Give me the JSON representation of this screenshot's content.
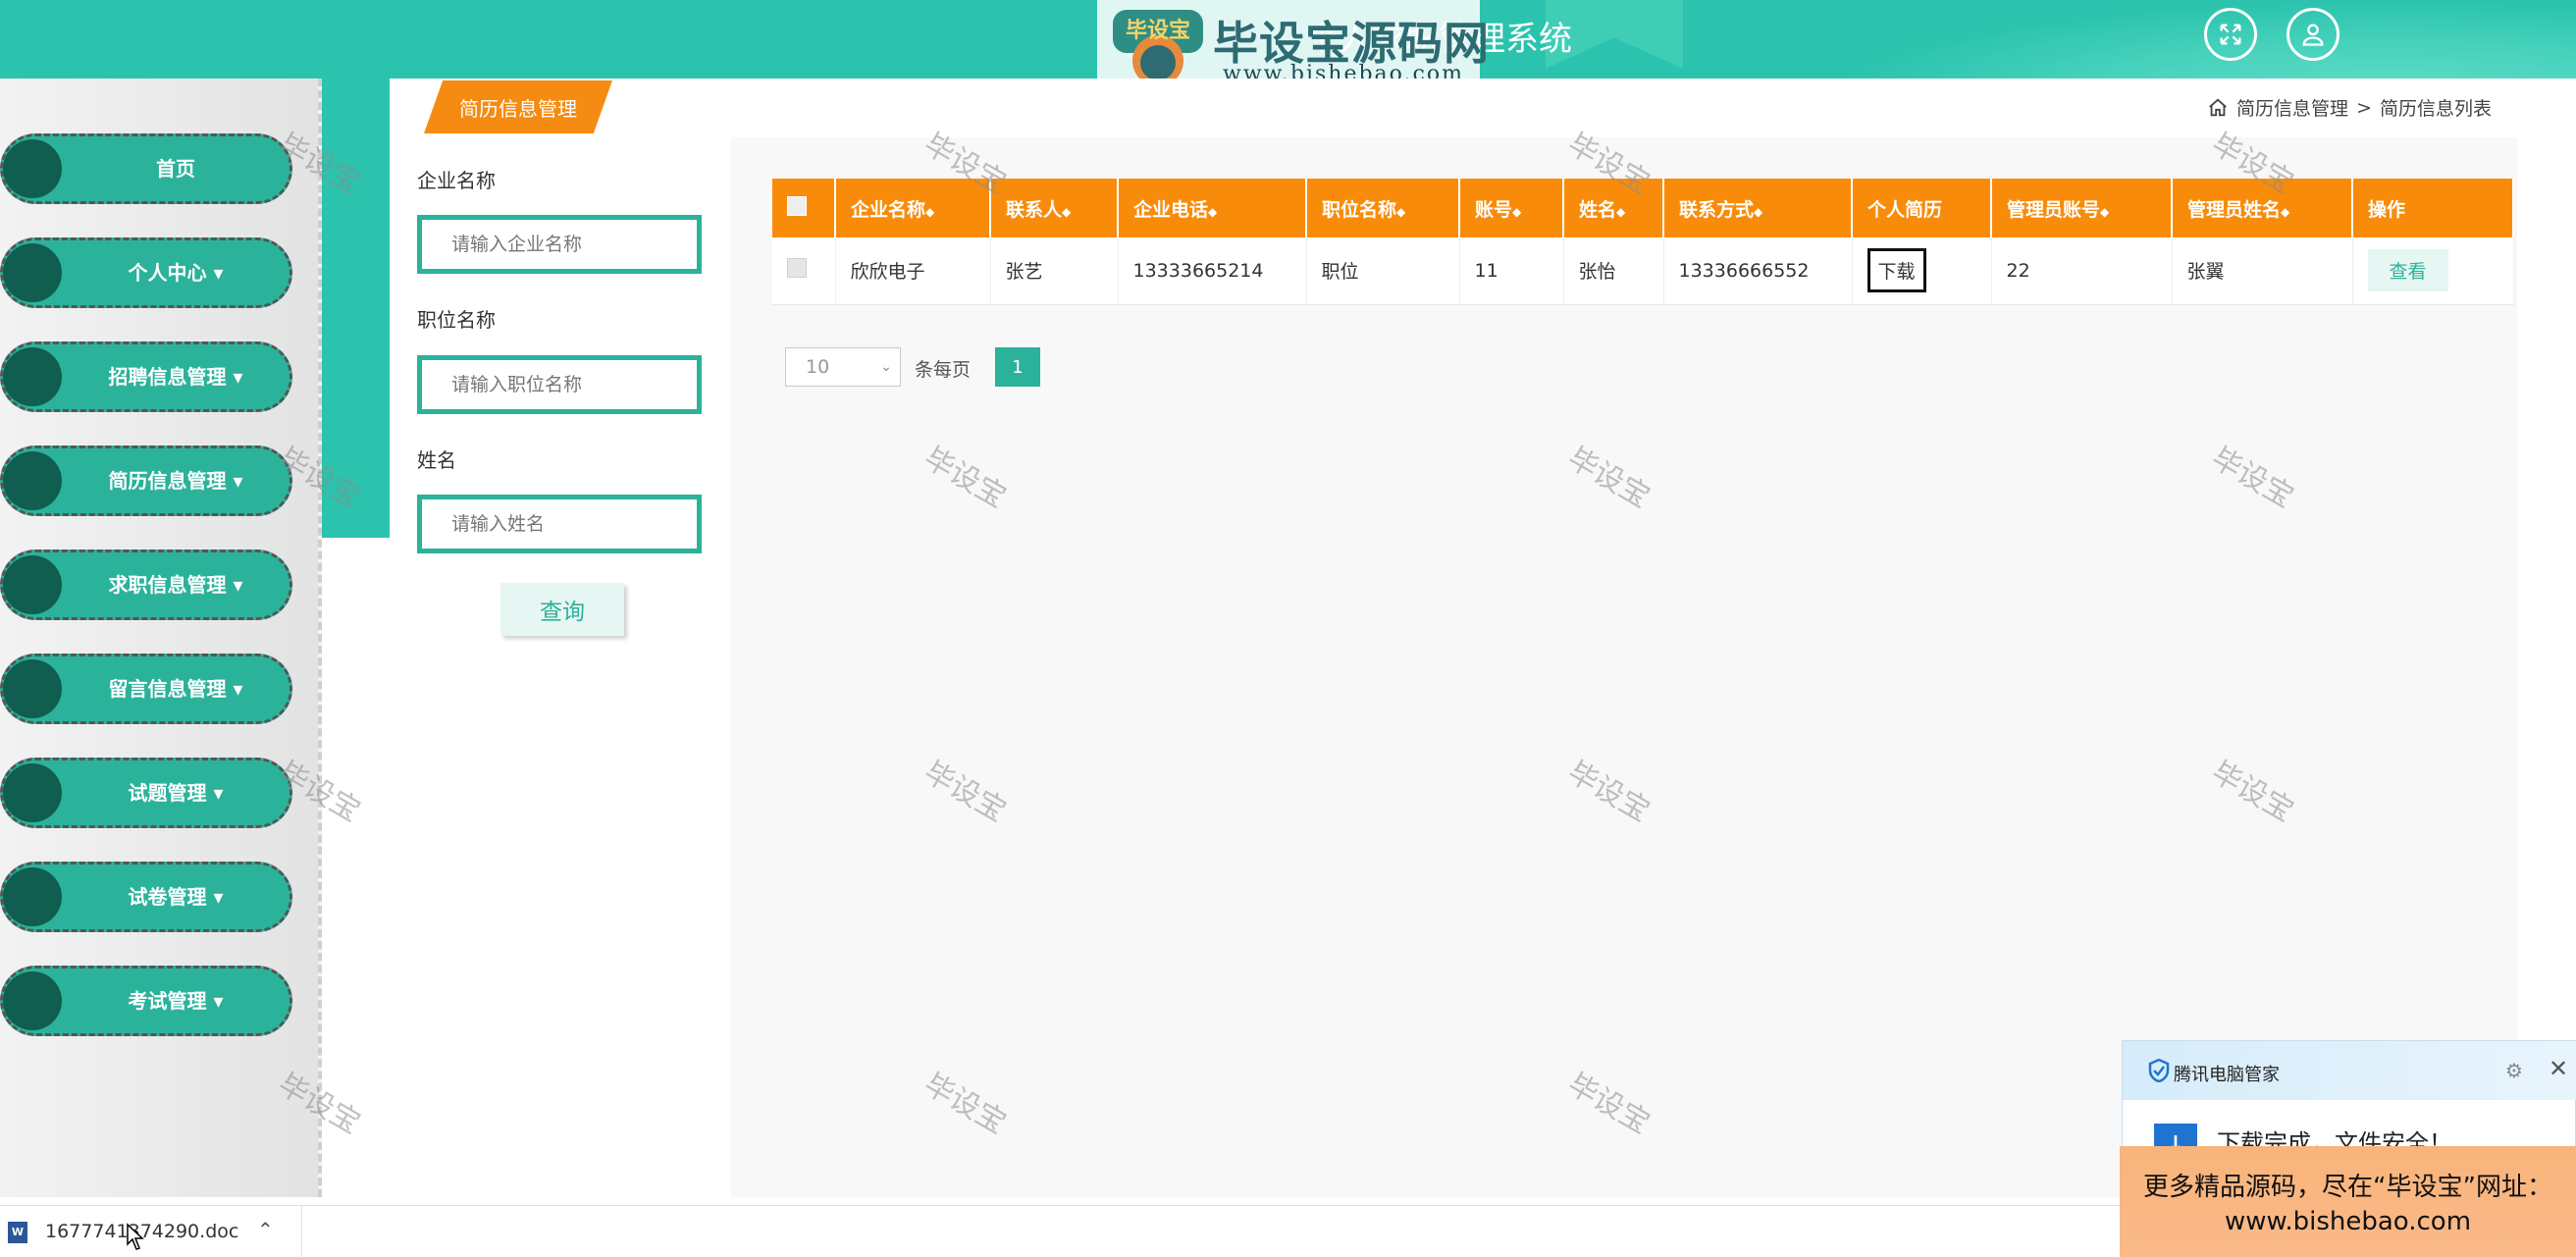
{
  "header": {
    "system_title": "个人求职管理系统",
    "icons": [
      "fullscreen-icon",
      "user-icon"
    ]
  },
  "watermark_logo": {
    "badge_text": "毕设宝",
    "main_text": "毕设宝源码网",
    "url": "www.bishebao.com"
  },
  "sidebar": {
    "items": [
      {
        "label": "首页"
      },
      {
        "label": "个人中心 ▾"
      },
      {
        "label": "招聘信息管理 ▾"
      },
      {
        "label": "简历信息管理 ▾"
      },
      {
        "label": "求职信息管理 ▾"
      },
      {
        "label": "留言信息管理 ▾"
      },
      {
        "label": "试题管理 ▾"
      },
      {
        "label": "试卷管理 ▾"
      },
      {
        "label": "考试管理 ▾"
      }
    ]
  },
  "panel": {
    "tab_label": "简历信息管理",
    "breadcrumb": {
      "home_icon": "home-icon",
      "level1": "简历信息管理",
      "separator": ">",
      "level2": "简历信息列表"
    }
  },
  "filters": {
    "company_label": "企业名称",
    "company_placeholder": "请输入企业名称",
    "position_label": "职位名称",
    "position_placeholder": "请输入职位名称",
    "name_label": "姓名",
    "name_placeholder": "请输入姓名",
    "query_button": "查询"
  },
  "table": {
    "columns": [
      "企业名称",
      "联系人",
      "企业电话",
      "职位名称",
      "账号",
      "姓名",
      "联系方式",
      "个人简历",
      "管理员账号",
      "管理员姓名",
      "操作"
    ],
    "sort_marker": "◆",
    "rows": [
      {
        "company": "欣欣电子",
        "contact": "张艺",
        "company_phone": "13333665214",
        "position": "职位",
        "account": "11",
        "name": "张怡",
        "contact_info": "13336666552",
        "resume_button": "下载",
        "admin_account": "22",
        "admin_name": "张翼",
        "action_button": "查看"
      }
    ]
  },
  "pagination": {
    "page_size": "10",
    "per_page_label": "条每页",
    "current_page": "1"
  },
  "watermark_text": "毕设宝",
  "download_bar": {
    "file_name": "1677741374290.doc",
    "file_type_icon": "word-icon"
  },
  "popup": {
    "title": "腾讯电脑管家",
    "message": "下载完成，文件安全！"
  },
  "promo": {
    "line1": "更多精品源码，尽在“毕设宝”网址：",
    "line2": "www.bishebao.com"
  },
  "colors": {
    "teal": "#2bc3ad",
    "dark_teal": "#0f5e4f",
    "orange": "#f88c0a"
  }
}
